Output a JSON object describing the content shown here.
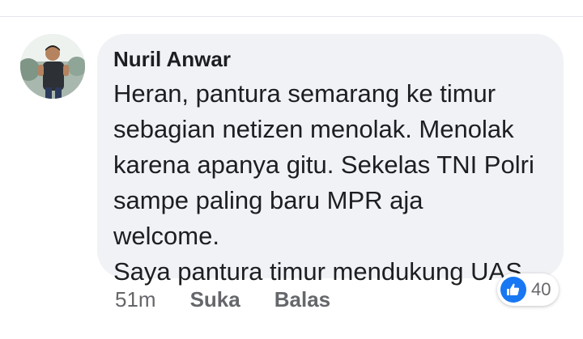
{
  "comment": {
    "author": "Nuril Anwar",
    "lines": [
      "Heran, pantura semarang ke timur",
      "sebagian netizen menolak. Menolak",
      "karena apanya gitu. Sekelas TNI Polri",
      "sampe paling baru MPR aja",
      "welcome.",
      "Saya pantura timur mendukung UAS."
    ],
    "timestamp": "51m",
    "like_label": "Suka",
    "reply_label": "Balas",
    "reaction_count": "40"
  },
  "colors": {
    "bubble": "#f0f2f5",
    "text": "#1c1e21",
    "secondary_text": "#65676b",
    "like_blue": "#1877f2"
  },
  "icons": {
    "reaction": "thumbs-up-icon",
    "avatar": "profile-photo"
  }
}
